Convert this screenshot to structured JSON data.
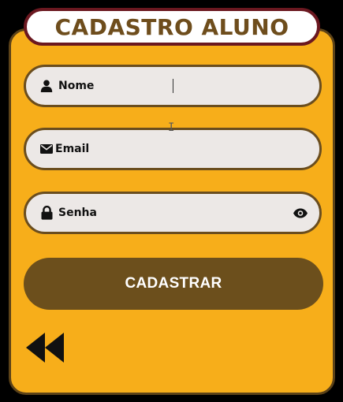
{
  "title": "CADASTRO ALUNO",
  "fields": {
    "nome": {
      "icon": "user-icon",
      "label": "Nome",
      "value": ""
    },
    "email": {
      "icon": "envelope-icon",
      "label": "Email",
      "value": ""
    },
    "senha": {
      "icon": "lock-icon",
      "label": "Senha",
      "value": "",
      "toggle_icon": "eye-icon"
    }
  },
  "submit_label": "CADASTRAR",
  "back_icon": "rewind-icon",
  "colors": {
    "card_background": "#f7ae1a",
    "card_border": "#5c4218",
    "title_border": "#6b1820",
    "title_text": "#6e4d1c",
    "field_background": "#ece8e6",
    "field_border": "#6a4d1e",
    "button_background": "#6c4f1c",
    "button_text": "#ffffff"
  }
}
